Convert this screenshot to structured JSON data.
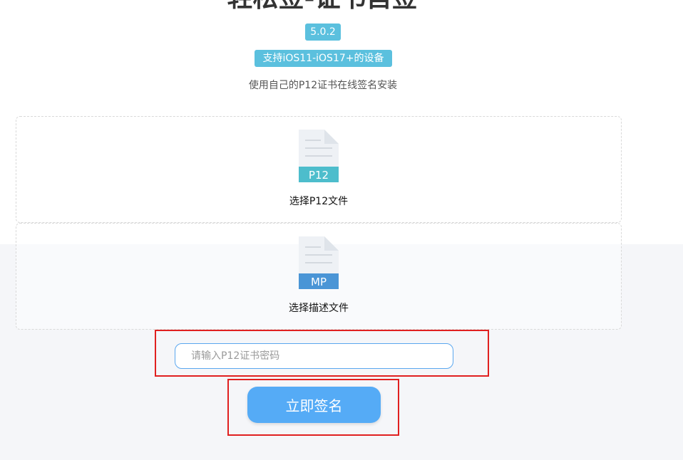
{
  "header": {
    "title": "轻松签-证书自签",
    "version_badge": "5.0.2",
    "support_badge": "支持iOS11-iOS17+的设备",
    "subtitle": "使用自己的P12证书在线签名安装"
  },
  "upload": {
    "p12": {
      "icon_text": "P12",
      "label": "选择P12文件",
      "icon": "p12-file-icon",
      "color": "#4dbdcc"
    },
    "mobileprovision": {
      "icon_text": "MP",
      "label": "选择描述文件",
      "icon": "mp-file-icon",
      "color": "#4a95d6"
    }
  },
  "password": {
    "placeholder": "请输入P12证书密码",
    "value": ""
  },
  "sign_button": {
    "label": "立即签名"
  },
  "colors": {
    "badge": "#5bc0de",
    "button": "#55abf6",
    "highlight": "#e02020"
  }
}
